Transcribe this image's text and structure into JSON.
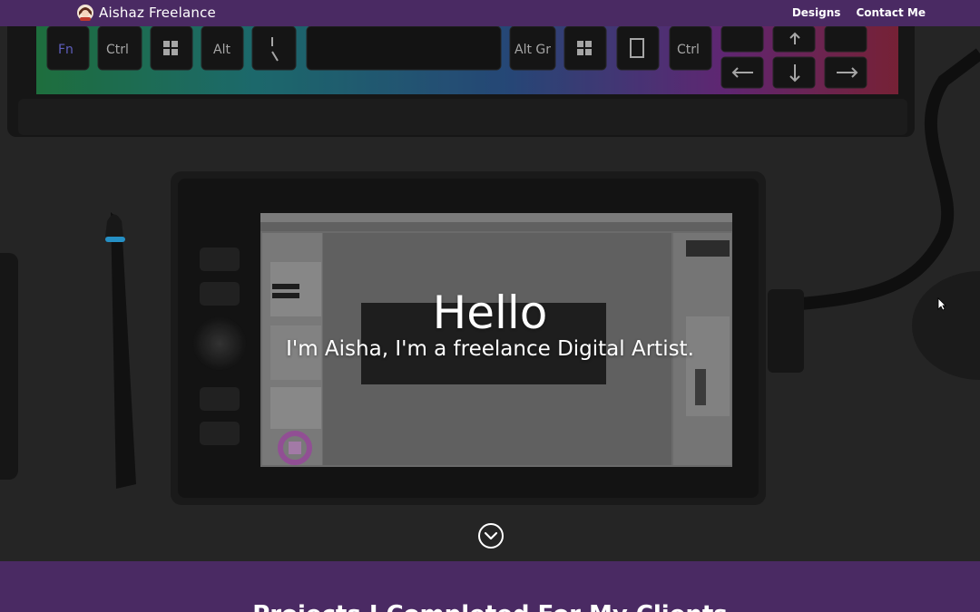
{
  "nav": {
    "brand": "Aishaz Freelance",
    "brand_logo_icon": "artist-avatar-icon",
    "links": [
      {
        "label": "Designs"
      },
      {
        "label": "Contact Me"
      }
    ]
  },
  "hero": {
    "title": "Hello",
    "subtitle": "I'm Aisha, I'm a freelance Digital Artist.",
    "scroll_icon": "chevron-down-circle-icon",
    "keyboard_keys": [
      "Fn",
      "Ctrl",
      "Alt",
      "Alt Gr",
      "Ctrl"
    ]
  },
  "section": {
    "title": "Projects I Completed For My Clients"
  },
  "colors": {
    "brand_purple": "#4a2a63",
    "hero_bg": "#2b2b2b",
    "text": "#ffffff"
  }
}
